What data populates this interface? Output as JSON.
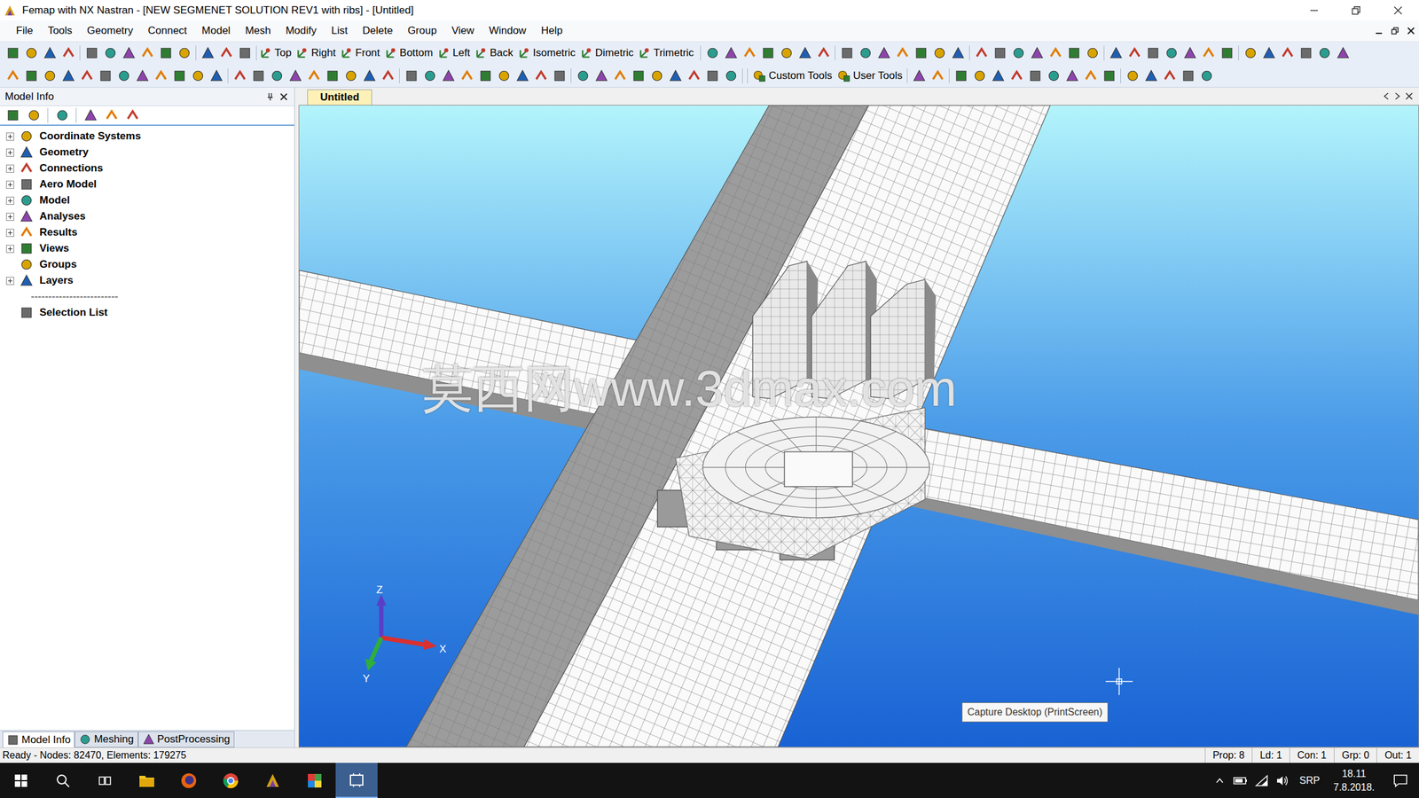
{
  "window": {
    "title": "Femap with NX Nastran - [NEW SEGMENET SOLUTION REV1 with ribs] - [Untitled]"
  },
  "menu": [
    "File",
    "Tools",
    "Geometry",
    "Connect",
    "Model",
    "Mesh",
    "Modify",
    "List",
    "Delete",
    "Group",
    "View",
    "Window",
    "Help"
  ],
  "toolbar": {
    "views": [
      "Top",
      "Right",
      "Front",
      "Bottom",
      "Left",
      "Back",
      "Isometric",
      "Dimetric",
      "Trimetric"
    ],
    "tools": [
      "Custom Tools",
      "User Tools"
    ]
  },
  "model_info": {
    "title": "Model Info",
    "items": [
      {
        "label": "Coordinate Systems",
        "kind": "node",
        "expandable": true
      },
      {
        "label": "Geometry",
        "kind": "node",
        "expandable": true
      },
      {
        "label": "Connections",
        "kind": "node",
        "expandable": true
      },
      {
        "label": "Aero Model",
        "kind": "node",
        "expandable": true
      },
      {
        "label": "Model",
        "kind": "node",
        "expandable": true
      },
      {
        "label": "Analyses",
        "kind": "node",
        "expandable": true
      },
      {
        "label": "Results",
        "kind": "node",
        "expandable": true
      },
      {
        "label": "Views",
        "kind": "node",
        "expandable": true
      },
      {
        "label": "Groups",
        "kind": "node",
        "expandable": false
      },
      {
        "label": "Layers",
        "kind": "node",
        "expandable": true
      },
      {
        "label": "-------------------------",
        "kind": "separator",
        "expandable": false
      },
      {
        "label": "Selection List",
        "kind": "node",
        "expandable": false
      }
    ]
  },
  "bottom_tabs": [
    {
      "label": "Model Info",
      "selected": true
    },
    {
      "label": "Meshing",
      "selected": false
    },
    {
      "label": "PostProcessing",
      "selected": false
    }
  ],
  "document_tabs": [
    {
      "label": "Untitled",
      "selected": true
    }
  ],
  "viewport": {
    "watermark": "莫西网www.3dmax.com",
    "axes": {
      "z": "Z",
      "x": "X",
      "y": "Y"
    },
    "tooltip": "Capture Desktop (PrintScreen)"
  },
  "status_bar": {
    "message": "Ready - Nodes: 82470, Elements: 179275",
    "fields": [
      "Prop: 8",
      "Ld: 1",
      "Con: 1",
      "Grp: 0",
      "Out: 1"
    ]
  },
  "taskbar": {
    "language": "SRP",
    "time": "18.11",
    "date": "7.8.2018."
  }
}
